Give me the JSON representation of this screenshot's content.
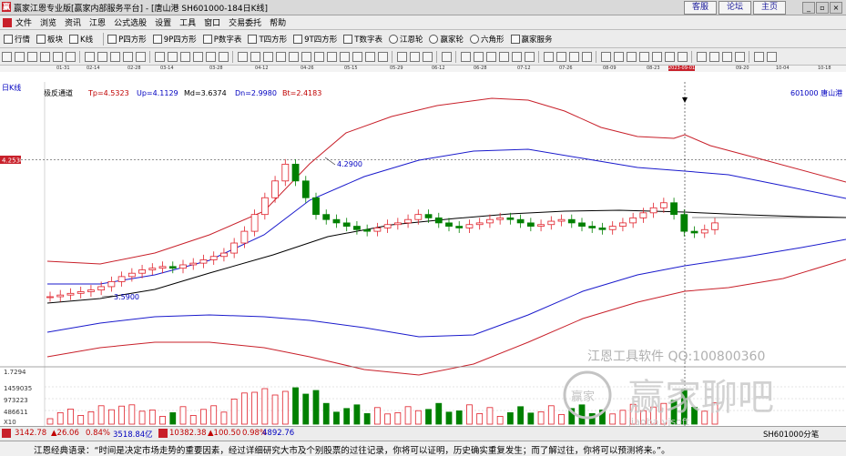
{
  "window": {
    "title": "赢家江恩专业版[赢家内部服务平台] - [唐山港  SH601000-184日K线]",
    "links": [
      "客服",
      "论坛",
      "主页"
    ]
  },
  "menu": [
    "文件",
    "浏览",
    "资讯",
    "江恩",
    "公式选股",
    "设置",
    "工具",
    "窗口",
    "交易委托",
    "帮助"
  ],
  "toolbar": [
    "行情",
    "板块",
    "K线",
    "P四方形",
    "9P四方形",
    "P数字表",
    "T四方形",
    "9T四方形",
    "T数字表",
    "江恩轮",
    "赢家轮",
    "六角形",
    "赢家服务"
  ],
  "dates": [
    "01-31",
    "02-14",
    "02-28",
    "03-14",
    "03-28",
    "04-12",
    "04-26",
    "05-15",
    "05-29",
    "06-12",
    "06-28",
    "07-12",
    "07-26",
    "08-09",
    "08-23",
    "2023-09-01",
    "09-20",
    "10-04",
    "10-18"
  ],
  "indicator": {
    "period_label": "日K线",
    "name": "极反通道",
    "tp": "Tp=4.5323",
    "up": "Up=4.1129",
    "md": "Md=3.6374",
    "dn": "Dn=2.9980",
    "bt": "Bt=2.4183",
    "stock": "601000  唐山港"
  },
  "chart": {
    "price_label_left": "4.2530",
    "high_label": "4.2900",
    "low_label": "3.5900",
    "volume_labels": [
      "1.7294",
      "1459035",
      "973223",
      "486611",
      "X10"
    ]
  },
  "watermark": {
    "line1": "江恩工具软件  QQ:100800360",
    "line2": "赢家聊吧",
    "line3": "jiaoba.yjsoft"
  },
  "status": {
    "sh": "3142.78",
    "sh_chg": "▲26.06",
    "sh_pct": "0.84%",
    "sh_amt": "3518.84亿",
    "sz": "10382.38",
    "sz_chg": "▲100.50",
    "sz_pct": "0.98%",
    "sz_amt": "4892.76",
    "right": "SH601000分笔"
  },
  "quote": "江恩经典语录：“时间是决定市场走势的重要因素，经过详细研究大市及个别股票的过往记录，你将可以证明，历史确实重复发生；而了解过往，你将可以预测将来。”。",
  "colors": {
    "up": "#e0202a",
    "down": "#008000",
    "band_outer": "#c8202a",
    "band_inner": "#1a1acc",
    "mid": "#000000"
  },
  "chart_data": {
    "type": "candlestick",
    "symbol": "601000",
    "approx_close": [
      3.46,
      3.47,
      3.48,
      3.49,
      3.5,
      3.52,
      3.55,
      3.58,
      3.6,
      3.62,
      3.63,
      3.64,
      3.63,
      3.65,
      3.66,
      3.68,
      3.7,
      3.72,
      3.78,
      3.85,
      3.95,
      4.05,
      4.15,
      4.25,
      4.15,
      4.05,
      3.95,
      3.92,
      3.9,
      3.88,
      3.86,
      3.85,
      3.87,
      3.89,
      3.9,
      3.92,
      3.95,
      3.93,
      3.9,
      3.88,
      3.87,
      3.89,
      3.9,
      3.92,
      3.93,
      3.92,
      3.9,
      3.88,
      3.89,
      3.91,
      3.92,
      3.9,
      3.88,
      3.87,
      3.86,
      3.88,
      3.9,
      3.93,
      3.96,
      3.99,
      4.02,
      3.95,
      3.85,
      3.84,
      3.86,
      3.9
    ]
  }
}
